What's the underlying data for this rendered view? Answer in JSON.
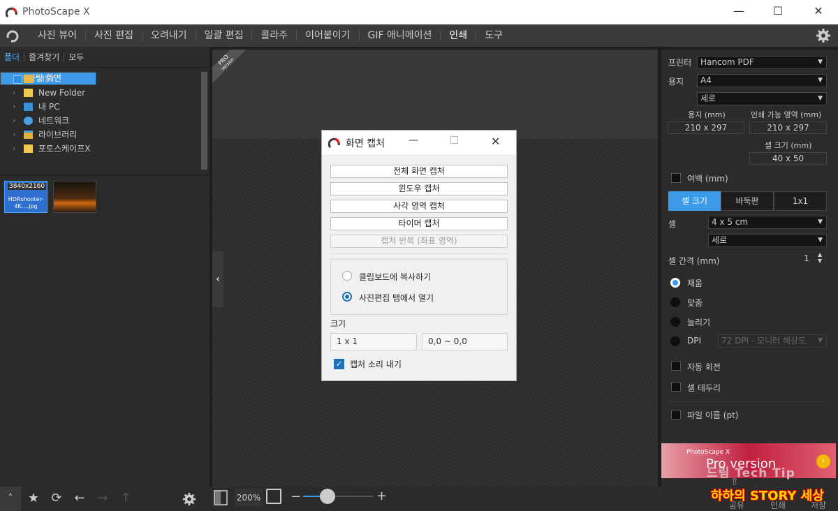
{
  "app": {
    "title": "PhotoScape X"
  },
  "window_controls": {
    "minimize": "—",
    "maximize": "☐",
    "close": "✕"
  },
  "menu": {
    "items": [
      "사진 뷰어",
      "사진 편집",
      "오려내기",
      "일괄 편집",
      "콜라주",
      "이어붙이기",
      "GIF 애니메이션",
      "인쇄",
      "도구"
    ],
    "active": "인쇄"
  },
  "left_panel": {
    "tabs": [
      "폴더",
      "즐겨찾기",
      "모두"
    ],
    "tree": [
      {
        "label": "바탕 화면",
        "selected": true,
        "icon": "desktop-icon"
      },
      {
        "label": "HSY",
        "icon": "user-folder-icon"
      },
      {
        "label": "New Folder",
        "icon": "folder-icon"
      },
      {
        "label": "내 PC",
        "icon": "pc-icon"
      },
      {
        "label": "네트워크",
        "icon": "network-icon"
      },
      {
        "label": "라이브러리",
        "icon": "library-icon"
      },
      {
        "label": "포토스케이프X",
        "icon": "folder-icon"
      }
    ],
    "thumbnails": [
      {
        "resolution": "3840x2160",
        "filename": "HDRshooter-4K….jpg"
      }
    ]
  },
  "canvas": {
    "pro_badge": "PRO",
    "pro_badge_sub": "Version",
    "collapse_arrow": "‹"
  },
  "dialog": {
    "title": "화면 캡처",
    "buttons": [
      "전체 화면 캡처",
      "윈도우 캡처",
      "사각 영역 캡처",
      "타이머 캡처"
    ],
    "disabled_button": "캡처 반복 (좌표 영역)",
    "radio_options": [
      {
        "label": "클립보드에 복사하기",
        "checked": false
      },
      {
        "label": "사진편집 탭에서 열기",
        "checked": true
      }
    ],
    "size_label": "크기",
    "size_value": "1 x 1",
    "coord_value": "0,0 ~ 0,0",
    "sound_label": "캡처 소리 내기",
    "sound_checked": true
  },
  "right_panel": {
    "printer_label": "프린터",
    "printer_value": "Hancom PDF",
    "paper_label": "용지",
    "paper_value": "A4",
    "orientation_value": "세로",
    "paper_mm_label": "용지 (mm)",
    "printable_label": "인쇄 가능 영역 (mm)",
    "paper_mm_value": "210 x 297",
    "printable_value": "210 x 297",
    "cell_size_mm_label": "셀 크기 (mm)",
    "cell_size_mm_value": "40 x 50",
    "margin_label": "여백 (mm)",
    "modes": [
      "셀 크기",
      "바둑판",
      "1x1"
    ],
    "active_mode": "셀 크기",
    "cell_label": "셀",
    "cell_value": "4 x 5 cm",
    "cell_orientation": "세로",
    "gap_label": "셀 간격 (mm)",
    "gap_value": "1",
    "fit_options": [
      "채움",
      "맞춤",
      "늘리기",
      "DPI"
    ],
    "fit_selected": "채움",
    "dpi_value": "72 DPI - 모니터 해상도",
    "auto_rotate_label": "자동 회전",
    "cell_border_label": "셀 테두리",
    "filename_label": "파일 이름 (pt)"
  },
  "banner": {
    "line1": "PhotoScape X",
    "line2": "Pro version"
  },
  "bottom": {
    "zoom": "200%",
    "zoom_fraction": 0.35,
    "right_labels": [
      "공유",
      "인쇄",
      "저장"
    ]
  },
  "watermark": {
    "line1": "드림 Tech Tip",
    "line2": "하하의 STORY 세상"
  },
  "colors": {
    "accent": "#3d9ae8",
    "menubar": "#3a3a3a",
    "panel": "#2b2b2b",
    "dialog": "#f0f0f0",
    "check": "#1d6fb8"
  }
}
